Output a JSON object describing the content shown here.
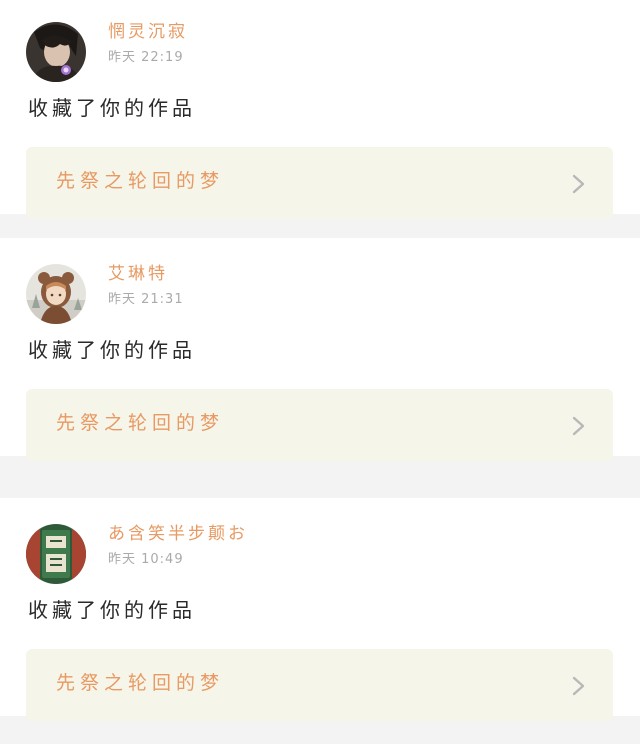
{
  "feed": {
    "items": [
      {
        "username": "惘灵沉寂",
        "timestamp": "昨天 22:19",
        "action": "收藏了你的作品",
        "work_title": "先祭之轮回的梦",
        "avatar_icon": "dark-haired-anime-avatar"
      },
      {
        "username": "艾琳特",
        "timestamp": "昨天 21:31",
        "action": "收藏了你的作品",
        "work_title": "先祭之轮回的梦",
        "avatar_icon": "anime-girl-bear-hood-avatar"
      },
      {
        "username": "あ含笑半步颠お",
        "timestamp": "昨天 10:49",
        "action": "收藏了你的作品",
        "work_title": "先祭之轮回的梦",
        "avatar_icon": "green-book-cover-avatar"
      }
    ]
  },
  "colors": {
    "accent": "#e79a63",
    "link_bg": "#f6f5ea",
    "separator": "#f3f3f3",
    "timestamp": "#aaaaaa",
    "text": "#2a2a2a",
    "chevron": "#b8b8b8"
  }
}
